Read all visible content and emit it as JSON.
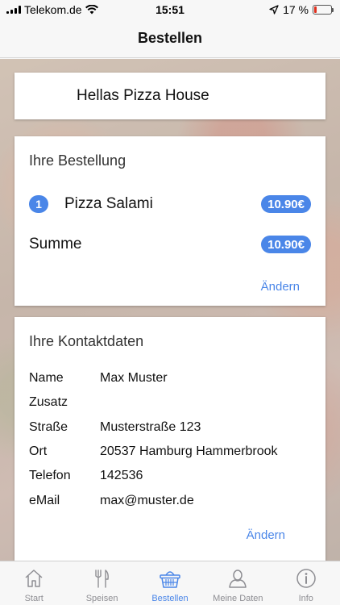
{
  "status_bar": {
    "carrier": "Telekom.de",
    "time": "15:51",
    "battery": "17 %",
    "battery_level": 0.17
  },
  "nav": {
    "title": "Bestellen"
  },
  "restaurant": {
    "name": "Hellas Pizza House"
  },
  "order": {
    "title": "Ihre Bestellung",
    "items": [
      {
        "qty": "1",
        "name": "Pizza Salami",
        "price": "10.90€"
      }
    ],
    "sum_label": "Summe",
    "sum_value": "10.90€",
    "change_label": "Ändern"
  },
  "contact": {
    "title": "Ihre Kontaktdaten",
    "rows": [
      {
        "label": "Name",
        "value": "Max Muster"
      },
      {
        "label": "Zusatz",
        "value": ""
      },
      {
        "label": "Straße",
        "value": "Musterstraße 123"
      },
      {
        "label": "Ort",
        "value": "20537 Hamburg Hammerbrook"
      },
      {
        "label": "Telefon",
        "value": "142536"
      },
      {
        "label": "eMail",
        "value": "max@muster.de"
      }
    ],
    "change_label": "Ändern"
  },
  "tabs": [
    {
      "label": "Start",
      "icon": "home-icon"
    },
    {
      "label": "Speisen",
      "icon": "cutlery-icon"
    },
    {
      "label": "Bestellen",
      "icon": "basket-icon",
      "active": true
    },
    {
      "label": "Meine Daten",
      "icon": "person-icon"
    },
    {
      "label": "Info",
      "icon": "info-icon"
    }
  ],
  "colors": {
    "accent": "#4a86e8",
    "tab_inactive": "#8e8e93",
    "battery_low": "#e0301e"
  }
}
